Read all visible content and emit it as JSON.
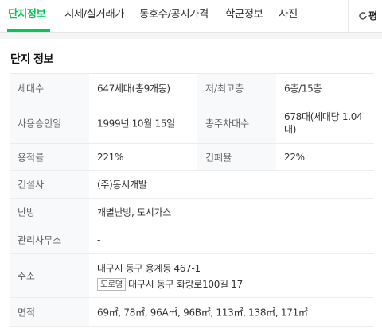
{
  "tabs": [
    {
      "label": "단지정보",
      "active": true
    },
    {
      "label": "시세/실거래가",
      "active": false
    },
    {
      "label": "동호수/공시가격",
      "active": false
    },
    {
      "label": "학군정보",
      "active": false
    },
    {
      "label": "사진",
      "active": false
    }
  ],
  "refresh": {
    "label": "평",
    "icon": "refresh-icon"
  },
  "section": {
    "title": "단지 정보"
  },
  "info": {
    "households": {
      "label": "세대수",
      "value": "647세대(총9개동)"
    },
    "floors": {
      "label": "저/최고층",
      "value": "6층/15층"
    },
    "approval_date": {
      "label": "사용승인일",
      "value": "1999년 10월 15일"
    },
    "parking": {
      "label": "총주차대수",
      "value": "678대(세대당 1.04대)"
    },
    "floor_area_ratio": {
      "label": "용적률",
      "value": "221%"
    },
    "building_coverage": {
      "label": "건폐율",
      "value": "22%"
    },
    "builder": {
      "label": "건설사",
      "value": "(주)동서개발"
    },
    "heating": {
      "label": "난방",
      "value": "개별난방, 도시가스"
    },
    "management_office": {
      "label": "관리사무소",
      "value": "-"
    },
    "address": {
      "label": "주소",
      "lot": "대구시 동구 용계동 467-1",
      "road_badge": "도로명",
      "road": "대구시 동구 화랑로100길 17"
    },
    "areas": {
      "label": "면적",
      "value": "69㎡, 78㎡, 96A㎡, 96B㎡, 113㎡, 138㎡, 171㎡"
    }
  },
  "colors": {
    "accent": "#03c75a",
    "header_bg": "#f8f9fa",
    "border": "#ececec"
  }
}
